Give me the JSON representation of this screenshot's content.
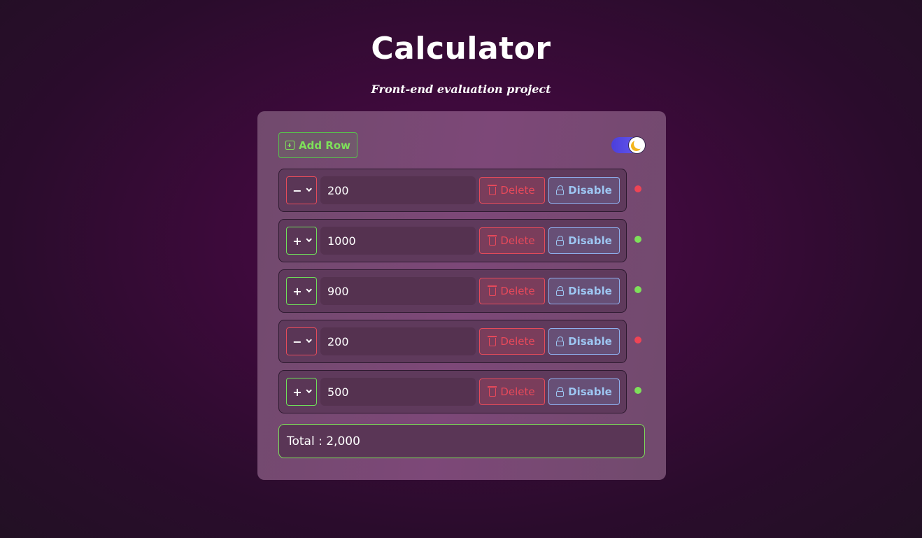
{
  "header": {
    "title": "Calculator",
    "subtitle": "Front-end evaluation project"
  },
  "toolbar": {
    "add_row_label": "Add Row",
    "theme_toggle_on": true
  },
  "rows": [
    {
      "operator": "−",
      "value": "200",
      "delete_label": "Delete",
      "disable_label": "Disable",
      "status": "negative"
    },
    {
      "operator": "+",
      "value": "1000",
      "delete_label": "Delete",
      "disable_label": "Disable",
      "status": "positive"
    },
    {
      "operator": "+",
      "value": "900",
      "delete_label": "Delete",
      "disable_label": "Disable",
      "status": "positive"
    },
    {
      "operator": "−",
      "value": "200",
      "delete_label": "Delete",
      "disable_label": "Disable",
      "status": "negative"
    },
    {
      "operator": "+",
      "value": "500",
      "delete_label": "Delete",
      "disable_label": "Disable",
      "status": "positive"
    }
  ],
  "total": {
    "label": "Total : 2,000"
  },
  "colors": {
    "positive": "#7ee05a",
    "negative": "#ee4455",
    "accent_blue": "#9dc6f2",
    "card_bg": "#7d4878"
  },
  "icons": {
    "add": "plus-square-icon",
    "delete": "trash-icon",
    "disable": "lock-icon",
    "theme": "moon-icon"
  }
}
